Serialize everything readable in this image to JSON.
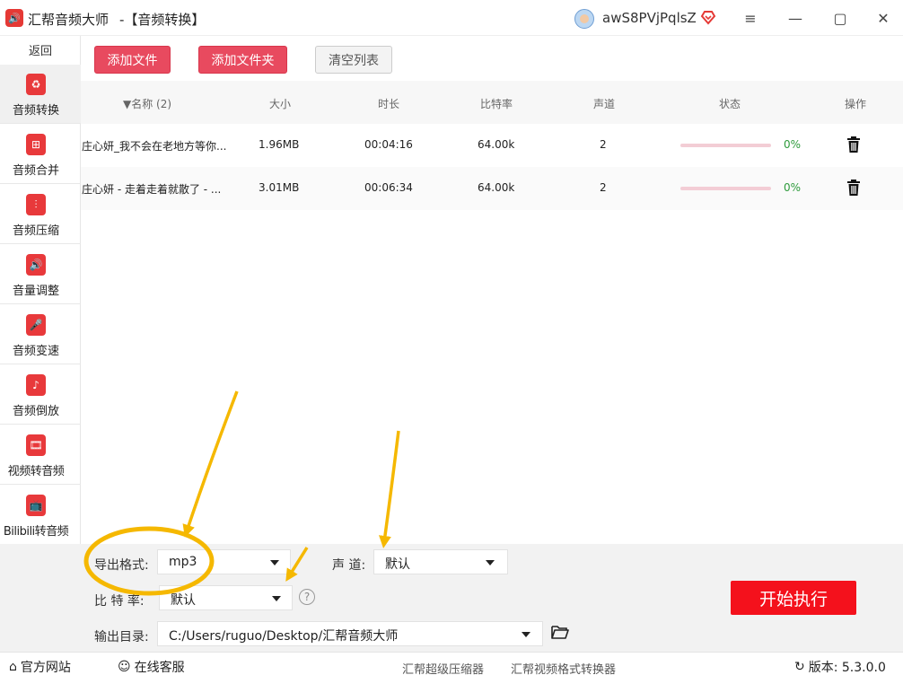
{
  "window": {
    "app_title": "汇帮音频大师",
    "subtitle": " -【音频转换】",
    "user_name": "awS8PVjPqlsZ",
    "logo_glyph": "🔊",
    "min_glyph": "—",
    "menu_glyph": "≡",
    "max_glyph": "▢",
    "close_glyph": "✕"
  },
  "sidebar": {
    "back_label": "返回",
    "items": [
      {
        "label": "音频转换",
        "icon": "audio-convert-icon",
        "glyph": "♻",
        "active": true
      },
      {
        "label": "音频合并",
        "icon": "audio-merge-icon",
        "glyph": "⊞",
        "active": false
      },
      {
        "label": "音频压缩",
        "icon": "audio-compress-icon",
        "glyph": "⫶",
        "active": false
      },
      {
        "label": "音量调整",
        "icon": "volume-icon",
        "glyph": "🔊",
        "active": false
      },
      {
        "label": "音频变速",
        "icon": "microphone-icon",
        "glyph": "🎤",
        "active": false
      },
      {
        "label": "音频倒放",
        "icon": "music-note-icon",
        "glyph": "♪",
        "active": false
      },
      {
        "label": "视频转音频",
        "icon": "film-icon",
        "glyph": "🎞",
        "active": false
      },
      {
        "label": "Bilibili转音频",
        "icon": "tv-icon",
        "glyph": "📺",
        "active": false
      }
    ]
  },
  "toolbar": {
    "add_file": "添加文件",
    "add_folder": "添加文件夹",
    "clear_list": "清空列表"
  },
  "table": {
    "columns": {
      "name": "▼名称 (2)",
      "size": "大小",
      "duration": "时长",
      "bitrate": "比特率",
      "channel": "声道",
      "status": "状态",
      "action": "操作"
    },
    "rows": [
      {
        "name": "庄心妍_我不会在老地方等你...",
        "size": "1.96MB",
        "duration": "00:04:16",
        "bitrate": "64.00k",
        "channel": "2",
        "progress": "0%"
      },
      {
        "name": "庄心妍 - 走着走着就散了 - ...",
        "size": "3.01MB",
        "duration": "00:06:34",
        "bitrate": "64.00k",
        "channel": "2",
        "progress": "0%"
      }
    ]
  },
  "settings": {
    "format_label": "导出格式:",
    "format_value": "mp3",
    "channel_label": "声 道:",
    "channel_value": "默认",
    "bitrate_label": "比 特 率:",
    "bitrate_value": "默认",
    "output_label": "输出目录:",
    "output_value": "C:/Users/ruguo/Desktop/汇帮音频大师",
    "help_glyph": "?",
    "start_button": "开始执行"
  },
  "footer": {
    "official_site": "官方网站",
    "online_service": "在线客服",
    "link1": "汇帮超级压缩器",
    "link2": "汇帮视频格式转换器",
    "version": "版本: 5.3.0.0",
    "home_glyph": "⌂",
    "service_glyph": "☺",
    "refresh_glyph": "↻"
  },
  "colors": {
    "accent": "#e84a5f",
    "start": "#f4111c",
    "progress_text": "#2e9b3c",
    "annotation": "#f5b800"
  }
}
